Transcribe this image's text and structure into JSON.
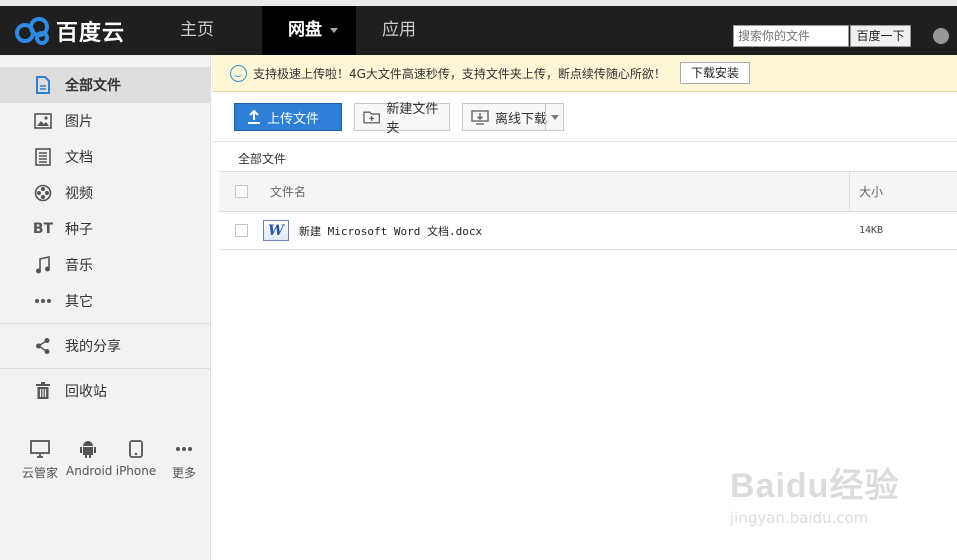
{
  "header": {
    "logo_text": "百度云",
    "nav": [
      {
        "label": "主页"
      },
      {
        "label": "网盘"
      },
      {
        "label": "应用"
      }
    ],
    "search": {
      "placeholder": "搜索你的文件",
      "button": "百度一下"
    }
  },
  "sidebar": {
    "items": [
      {
        "label": "全部文件",
        "icon": "file-icon"
      },
      {
        "label": "图片",
        "icon": "image-icon"
      },
      {
        "label": "文档",
        "icon": "document-icon"
      },
      {
        "label": "视频",
        "icon": "video-icon"
      },
      {
        "label": "种子",
        "icon": "bt-icon",
        "icon_text": "BT"
      },
      {
        "label": "音乐",
        "icon": "music-icon"
      },
      {
        "label": "其它",
        "icon": "more-icon"
      }
    ],
    "share": {
      "label": "我的分享"
    },
    "recycle": {
      "label": "回收站"
    },
    "devices": [
      {
        "label": "云管家"
      },
      {
        "label": "Android"
      },
      {
        "label": "iPhone"
      },
      {
        "label": "更多"
      }
    ]
  },
  "notice": {
    "text": "支持极速上传啦！4G大文件高速秒传，支持文件夹上传，断点续传随心所欲！",
    "button": "下载安装"
  },
  "toolbar": {
    "upload": "上传文件",
    "new_folder": "新建文件夹",
    "offline": "离线下载"
  },
  "breadcrumb": "全部文件",
  "table": {
    "col_name": "文件名",
    "col_size": "大小",
    "rows": [
      {
        "name": "新建 Microsoft Word 文档.docx",
        "size": "14KB",
        "icon_letter": "W"
      }
    ]
  },
  "watermark": {
    "main": "Baidu经验",
    "sub": "jingyan.baidu.com"
  },
  "colors": {
    "accent": "#2e7fd6",
    "topbar": "#1f1f1f",
    "notice_bg": "#fbf6d6"
  }
}
